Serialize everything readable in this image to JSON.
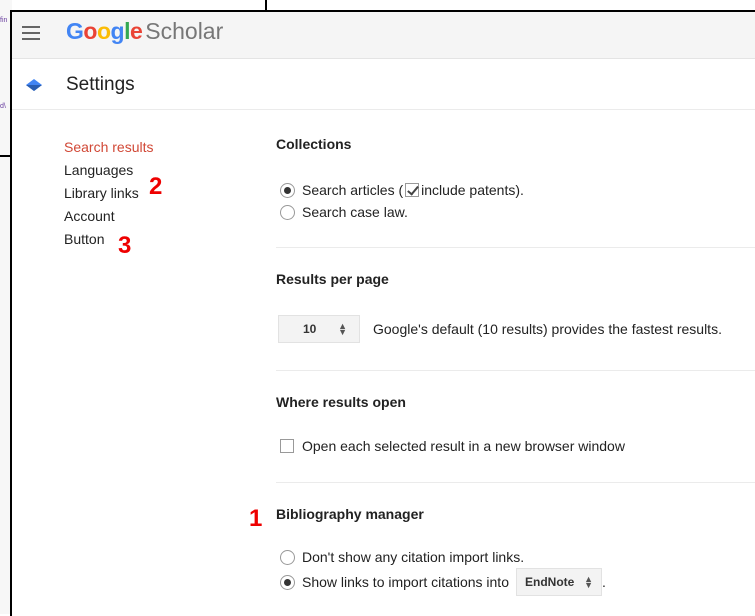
{
  "background_window": {
    "fragment_top": "fin",
    "fragment_bottom": "d\\"
  },
  "header": {
    "logo_google": "Google",
    "logo_scholar": "Scholar",
    "logo_colors": [
      "#4285f4",
      "#ea4335",
      "#fbbc05",
      "#4285f4",
      "#34a853",
      "#ea4335"
    ]
  },
  "settings_bar": {
    "title": "Settings"
  },
  "nav": {
    "items": [
      {
        "label": "Search results",
        "active": true
      },
      {
        "label": "Languages"
      },
      {
        "label": "Library links"
      },
      {
        "label": "Account"
      },
      {
        "label": "Button"
      }
    ]
  },
  "annotations": {
    "one": "1",
    "two": "2",
    "three": "3"
  },
  "collections": {
    "title": "Collections",
    "articles_prefix": "Search articles (",
    "articles_suffix": "include patents).",
    "case_law": "Search case law."
  },
  "results_per_page": {
    "title": "Results per page",
    "value": "10",
    "note": "Google's default (10 results) provides the fastest results."
  },
  "where_results_open": {
    "title": "Where results open",
    "option": "Open each selected result in a new browser window"
  },
  "bibliography": {
    "title": "Bibliography manager",
    "no_links": "Don't show any citation import links.",
    "show_links": "Show links to import citations into",
    "manager": "EndNote",
    "trailing": "."
  }
}
